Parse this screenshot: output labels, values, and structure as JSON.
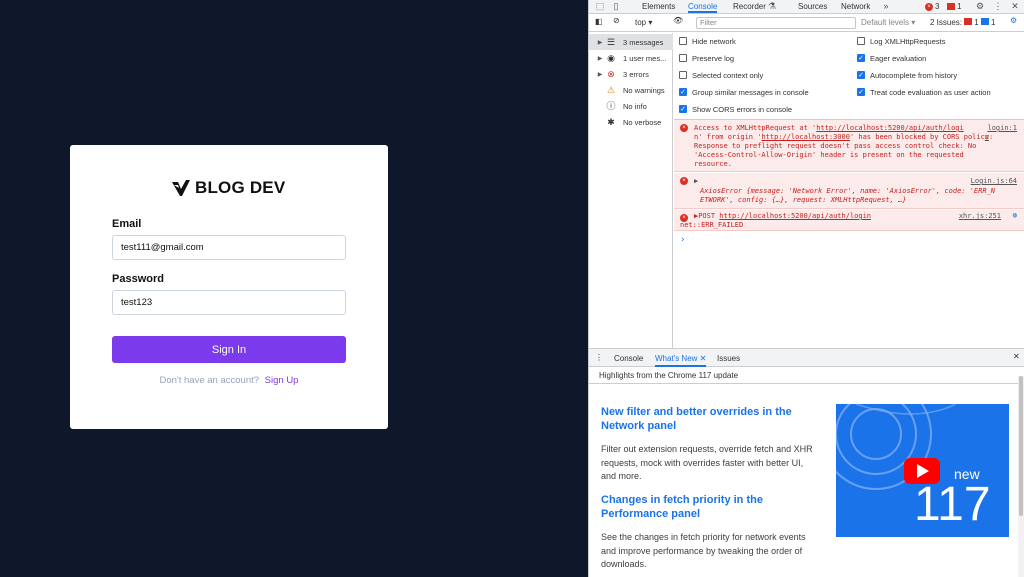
{
  "app": {
    "brand": "BLOG DEV",
    "email_label": "Email",
    "email_value": "test111@gmail.com",
    "password_label": "Password",
    "password_value": "test123",
    "signin_label": "Sign In",
    "no_account_text": "Don't have an account?",
    "signup_label": "Sign Up",
    "accent_color": "#7c3aed"
  },
  "devtools": {
    "tabs": [
      "Elements",
      "Console",
      "Recorder",
      "Sources",
      "Network"
    ],
    "active_tab": "Console",
    "error_count": "3",
    "warning_count": "1",
    "context": "top",
    "filter_placeholder": "Filter",
    "default_levels": "Default levels",
    "issues_label": "2 Issues:",
    "issues_err": "1",
    "issues_info": "1",
    "sidebar": [
      {
        "label": "3 messages",
        "icon": "list-icon"
      },
      {
        "label": "1 user mes...",
        "icon": "user-icon"
      },
      {
        "label": "3 errors",
        "icon": "error-icon"
      },
      {
        "label": "No warnings",
        "icon": "warning-icon"
      },
      {
        "label": "No info",
        "icon": "info-icon"
      },
      {
        "label": "No verbose",
        "icon": "bug-icon"
      }
    ],
    "settings_left": [
      {
        "label": "Hide network",
        "checked": false
      },
      {
        "label": "Preserve log",
        "checked": false
      },
      {
        "label": "Selected context only",
        "checked": false
      },
      {
        "label": "Group similar messages in console",
        "checked": true
      },
      {
        "label": "Show CORS errors in console",
        "checked": true
      }
    ],
    "settings_right": [
      {
        "label": "Log XMLHttpRequests",
        "checked": false
      },
      {
        "label": "Eager evaluation",
        "checked": true
      },
      {
        "label": "Autocomplete from history",
        "checked": true
      },
      {
        "label": "Treat code evaluation as user action",
        "checked": true
      }
    ],
    "messages": {
      "m1_l1": "Access to XMLHttpRequest at '",
      "m1_url1": "http://localhost:5200/api/auth/logi",
      "m1_l2a": "n' from origin '",
      "m1_url2": "http://localhost:3000",
      "m1_l2b": "' has been blocked by CORS policy:",
      "m1_l3": "Response to preflight request doesn't pass access control check: No",
      "m1_l4": "'Access-Control-Allow-Origin' header is present on the requested",
      "m1_l5": "resource.",
      "m1_src": "login:1",
      "m1_src2": "n",
      "m2_src": "Login.js:64",
      "m2_l1": "AxiosError {message: 'Network Error', name: 'AxiosError', code: 'ERR_N",
      "m2_l2": "ETWORK', config: {…}, request: XMLHttpRequest, …}",
      "m3_method": "POST",
      "m3_url": "http://localhost:5200/api/auth/login",
      "m3_src": "xhr.js:251",
      "m3_l2": "net::ERR_FAILED"
    },
    "drawer_tabs": [
      "Console",
      "What's New",
      "Issues"
    ],
    "drawer_active": "What's New",
    "highlights": "Highlights from the Chrome 117 update",
    "whatsnew": {
      "h1": "New filter and better overrides in the Network panel",
      "p1": "Filter out extension requests, override fetch and XHR requests, mock with overrides faster with better UI, and more.",
      "h2": "Changes in fetch priority in the Performance panel",
      "p2": "See the changes in fetch priority for network events and improve performance by tweaking the order of downloads.",
      "image_new": "new",
      "image_num": "117"
    }
  }
}
